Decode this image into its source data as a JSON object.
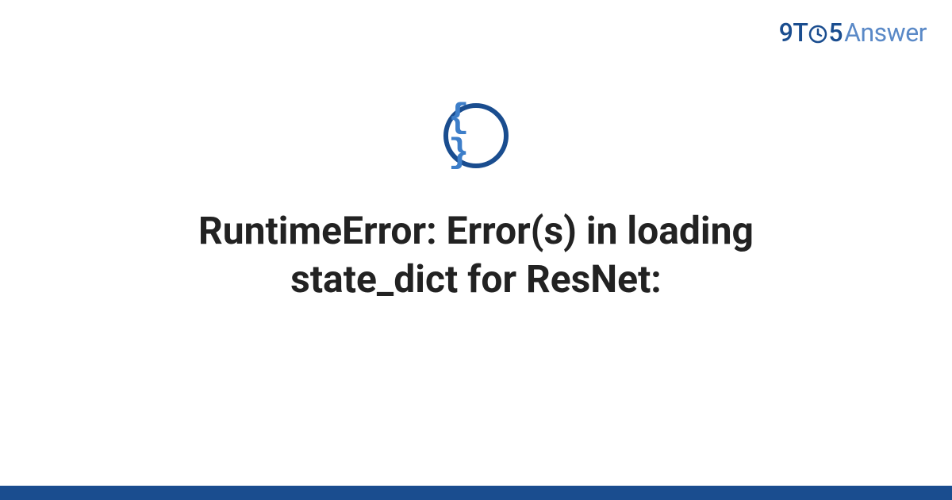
{
  "header": {
    "logo": {
      "nine": "9",
      "t": "T",
      "clock_icon": "clock-icon",
      "five": "5",
      "answer": "Answer"
    }
  },
  "icon": {
    "name": "code-braces-icon",
    "braces": "{ }"
  },
  "title": "RuntimeError: Error(s) in loading state_dict for ResNet:",
  "colors": {
    "primary": "#1a4d8f",
    "secondary": "#5a89c7",
    "text": "#222222"
  }
}
